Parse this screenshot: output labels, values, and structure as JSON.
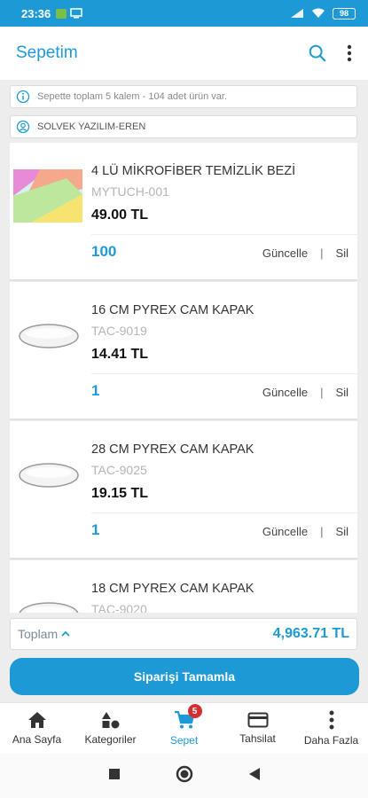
{
  "status_bar": {
    "time": "23:36",
    "battery": "98"
  },
  "app_bar": {
    "title": "Sepetim"
  },
  "info": {
    "summary": "Sepette toplam 5 kalem - 104 adet ürün var.",
    "customer": "SOLVEK YAZILIM-EREN"
  },
  "items": [
    {
      "name": "4 LÜ MİKROFİBER TEMİZLİK BEZİ",
      "code": "MYTUCH-001",
      "price": "49.00 TL",
      "qty": "100"
    },
    {
      "name": "16 CM PYREX CAM KAPAK",
      "code": "TAC-9019",
      "price": "14.41 TL",
      "qty": "1"
    },
    {
      "name": "28 CM PYREX CAM KAPAK",
      "code": "TAC-9025",
      "price": "19.15 TL",
      "qty": "1"
    },
    {
      "name": "18 CM PYREX CAM KAPAK",
      "code": "TAC-9020",
      "price": "",
      "qty": ""
    }
  ],
  "item_actions": {
    "update": "Güncelle",
    "separator": "|",
    "delete": "Sil"
  },
  "total": {
    "label": "Toplam",
    "value": "4,963.71 TL"
  },
  "complete_button": "Siparişi Tamamla",
  "bottom_nav": [
    {
      "label": "Ana Sayfa",
      "icon": "home-icon"
    },
    {
      "label": "Kategoriler",
      "icon": "categories-icon"
    },
    {
      "label": "Sepet",
      "icon": "cart-icon",
      "badge": "5",
      "active": true
    },
    {
      "label": "Tahsilat",
      "icon": "card-icon"
    },
    {
      "label": "Daha Fazla",
      "icon": "more-vert-icon"
    }
  ],
  "colors": {
    "accent": "#1d9ad6",
    "badge": "#d32f2f"
  }
}
